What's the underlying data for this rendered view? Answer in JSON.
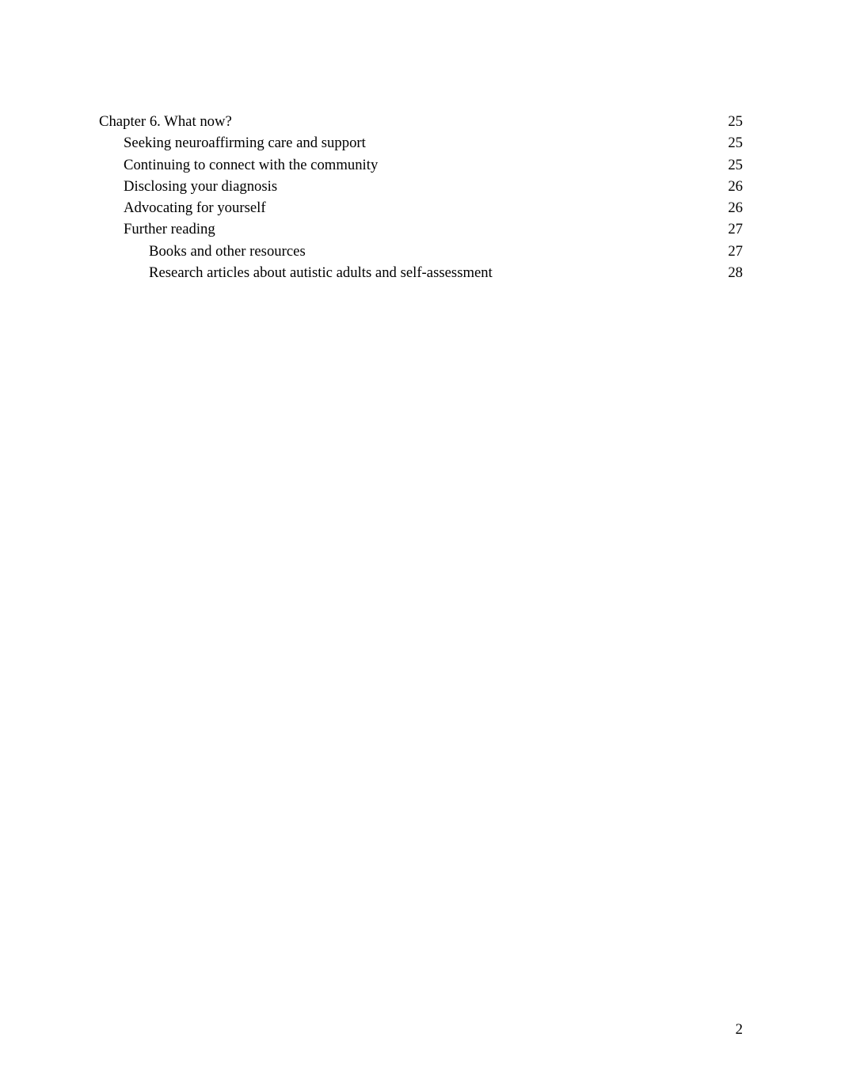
{
  "toc": {
    "entries": [
      {
        "title": "Chapter 6. What now?",
        "page": "25",
        "level": 1
      },
      {
        "title": "Seeking neuroaffirming care and support",
        "page": "25",
        "level": 2
      },
      {
        "title": "Continuing to connect with the community",
        "page": "25",
        "level": 2
      },
      {
        "title": "Disclosing your diagnosis",
        "page": "26",
        "level": 2
      },
      {
        "title": "Advocating for yourself",
        "page": "26",
        "level": 2
      },
      {
        "title": "Further reading",
        "page": "27",
        "level": 2
      },
      {
        "title": "Books and other resources",
        "page": "27",
        "level": 3
      },
      {
        "title": "Research articles about autistic adults and self-assessment",
        "page": "28",
        "level": 3
      }
    ]
  },
  "footer": {
    "page_number": "2"
  }
}
